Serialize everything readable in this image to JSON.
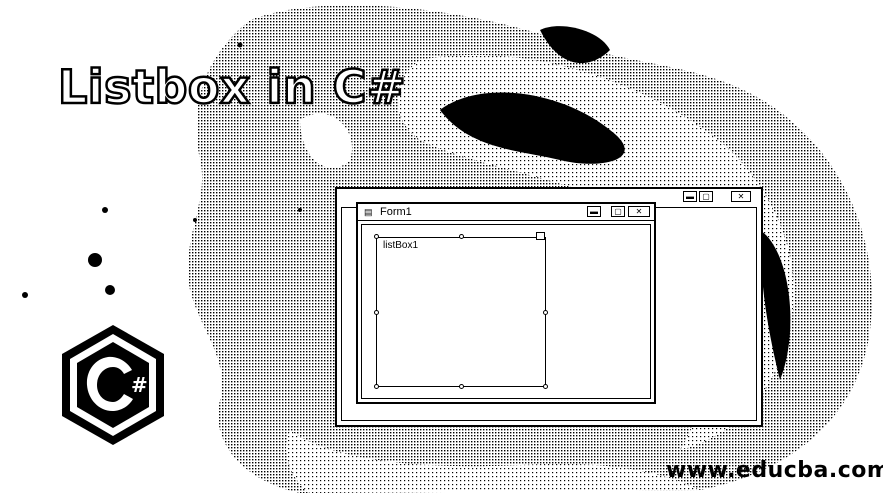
{
  "title": "Listbox in C#",
  "watermark": "www.educba.com",
  "logo": {
    "icon": "csharp-logo-icon",
    "glyph": "#"
  },
  "designer": {
    "window_buttons": [
      "minimize-icon",
      "maximize-icon",
      "close-icon"
    ],
    "form": {
      "title": "Form1",
      "icon": "form-icon",
      "buttons": [
        "minimize-icon",
        "maximize-icon",
        "close-icon"
      ]
    },
    "listbox": {
      "label": "listBox1"
    }
  },
  "colors": {
    "ink": "#000000",
    "paper": "#ffffff"
  }
}
